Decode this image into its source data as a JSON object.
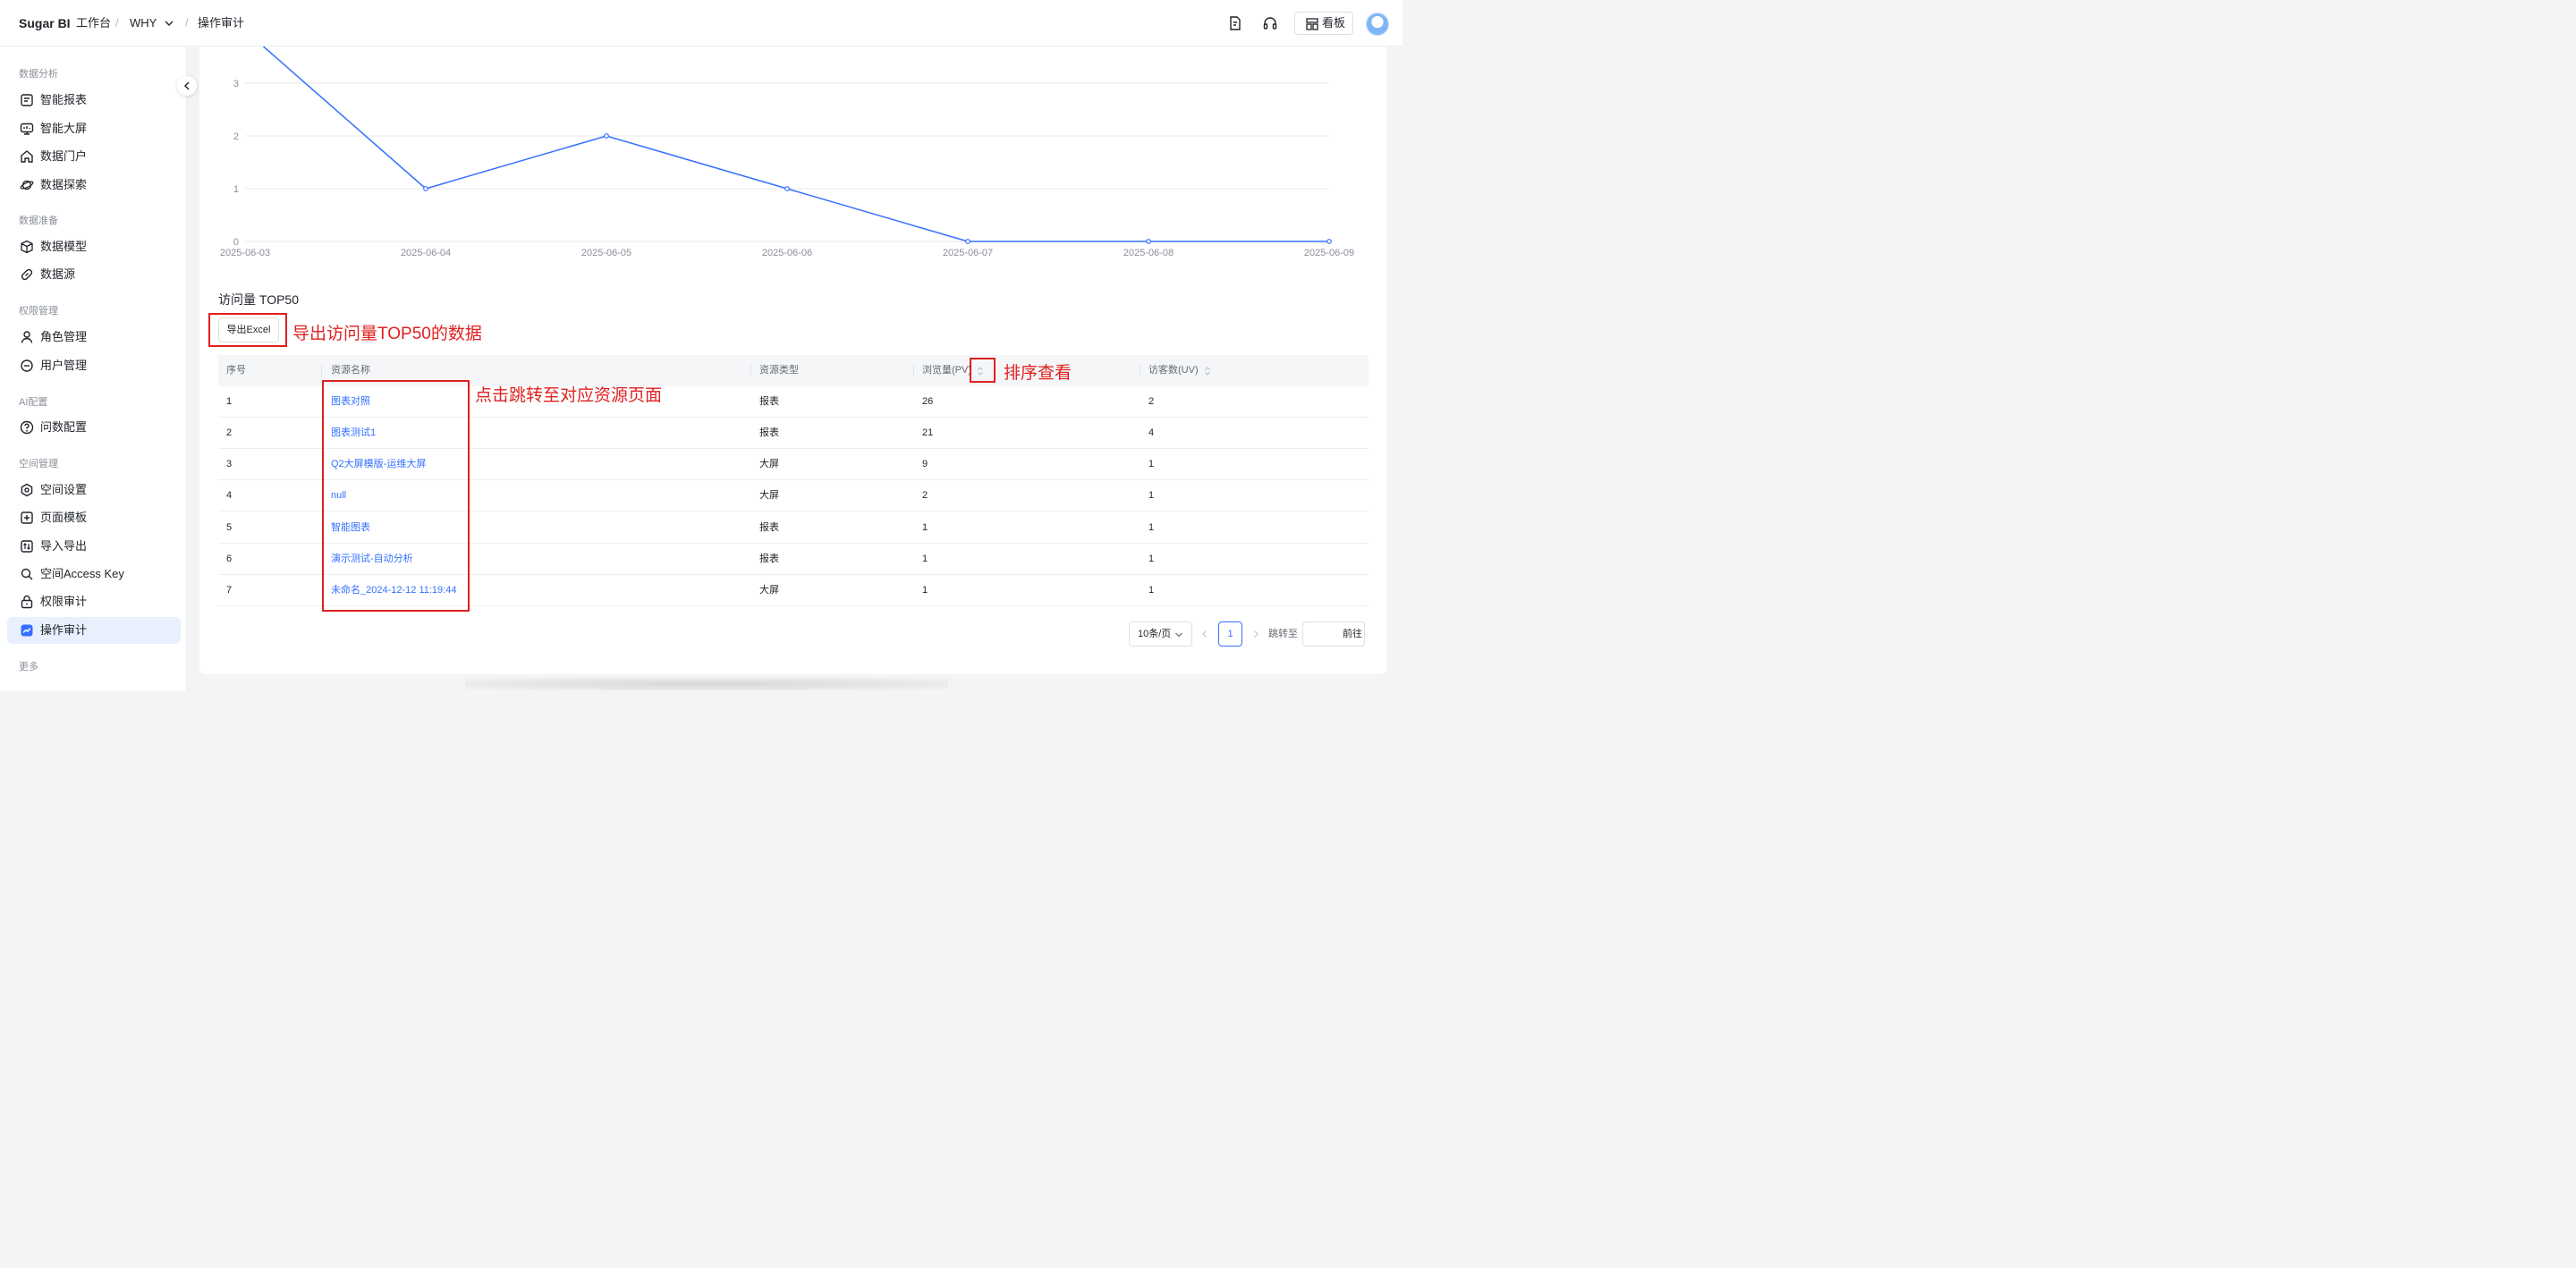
{
  "header": {
    "brand": "Sugar BI",
    "workspace": "工作台",
    "space": "WHY",
    "page": "操作审计",
    "kanban_label": "看板",
    "separator": "/"
  },
  "sidebar": {
    "sections": [
      {
        "title": "数据分析",
        "items": [
          {
            "label": "智能报表",
            "icon": "report-icon"
          },
          {
            "label": "智能大屏",
            "icon": "dashboard-screen-icon"
          },
          {
            "label": "数据门户",
            "icon": "home-icon"
          },
          {
            "label": "数据探索",
            "icon": "planet-icon"
          }
        ]
      },
      {
        "title": "数据准备",
        "items": [
          {
            "label": "数据模型",
            "icon": "cube-icon"
          },
          {
            "label": "数据源",
            "icon": "link-icon"
          }
        ]
      },
      {
        "title": "权限管理",
        "items": [
          {
            "label": "角色管理",
            "icon": "user-icon"
          },
          {
            "label": "用户管理",
            "icon": "user-minus-icon"
          }
        ]
      },
      {
        "title": "AI配置",
        "items": [
          {
            "label": "问数配置",
            "icon": "question-icon"
          }
        ]
      },
      {
        "title": "空间管理",
        "items": [
          {
            "label": "空间设置",
            "icon": "settings-icon"
          },
          {
            "label": "页面模板",
            "icon": "template-icon"
          },
          {
            "label": "导入导出",
            "icon": "import-export-icon"
          },
          {
            "label": "空间Access Key",
            "icon": "key-icon"
          },
          {
            "label": "权限审计",
            "icon": "lock-icon"
          },
          {
            "label": "操作审计",
            "icon": "audit-icon",
            "active": true
          }
        ]
      },
      {
        "title": "更多",
        "items": []
      }
    ]
  },
  "chart_data": {
    "type": "line",
    "x": [
      "2025-06-03",
      "2025-06-04",
      "2025-06-05",
      "2025-06-06",
      "2025-06-07",
      "2025-06-08",
      "2025-06-09"
    ],
    "series": [
      {
        "values": [
          4,
          1,
          2,
          1,
          0,
          0,
          0
        ]
      }
    ],
    "y_ticks": [
      "0",
      "1",
      "2",
      "3"
    ],
    "ylim": [
      0,
      3
    ],
    "grid": true,
    "color": "#3370ff"
  },
  "top50": {
    "title": "访问量 TOP50",
    "export_label": "导出Excel",
    "columns": [
      "序号",
      "资源名称",
      "资源类型",
      "浏览量(PV)",
      "访客数(UV)"
    ],
    "rows": [
      [
        "1",
        "图表对照",
        "报表",
        "26",
        "2"
      ],
      [
        "2",
        "图表测试1",
        "报表",
        "21",
        "4"
      ],
      [
        "3",
        "Q2大屏模版-运维大屏",
        "大屏",
        "9",
        "1"
      ],
      [
        "4",
        "null",
        "大屏",
        "2",
        "1"
      ],
      [
        "5",
        "智能图表",
        "报表",
        "1",
        "1"
      ],
      [
        "6",
        "演示测试-自动分析",
        "报表",
        "1",
        "1"
      ],
      [
        "7",
        "未命名_2024-12-12 11:19:44",
        "大屏",
        "1",
        "1"
      ]
    ]
  },
  "annotations": {
    "export": "导出访问量TOP50的数据",
    "jump": "点击跳转至对应资源页面",
    "sort": "排序查看",
    "color": "#e02020"
  },
  "pagination": {
    "page_size": "10条/页",
    "current_page": "1",
    "jump_label": "跳转至",
    "go_label": "前往"
  }
}
